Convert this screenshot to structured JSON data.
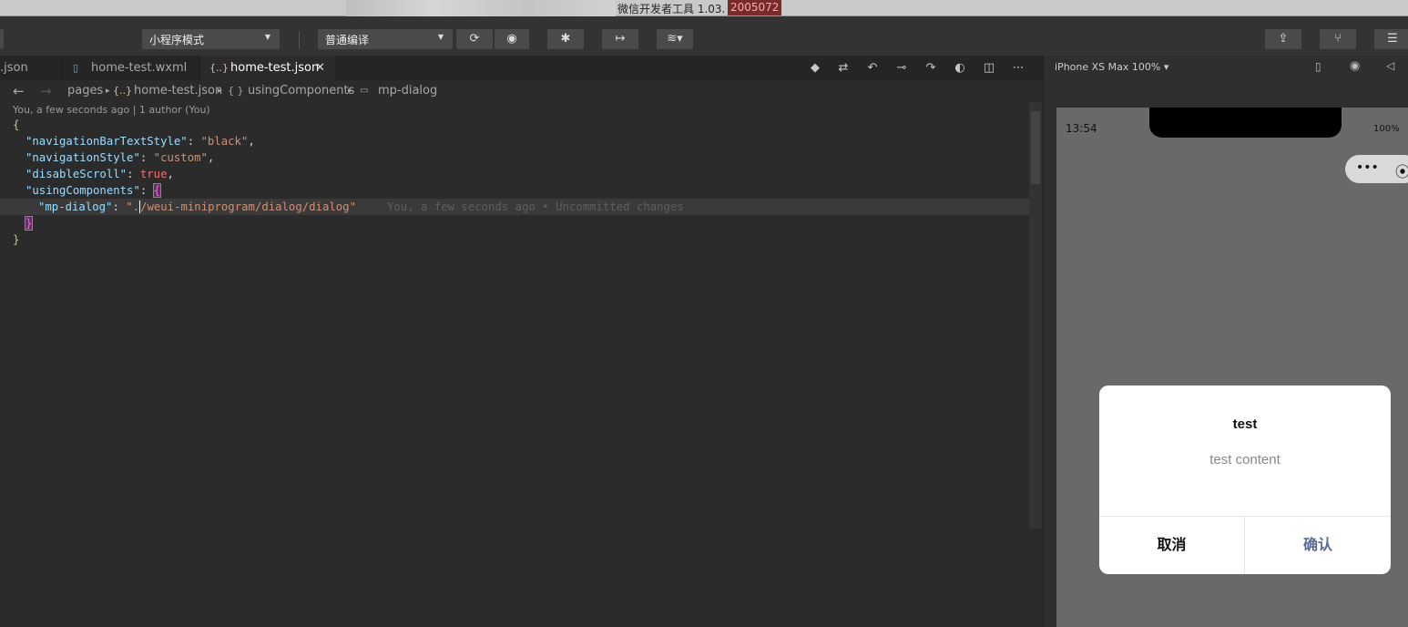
{
  "window": {
    "title": "微信开发者工具 1.03.",
    "build": "2005072"
  },
  "toolbar": {
    "mode_select": "小程序模式",
    "compile_select": "普通编译"
  },
  "tabs": [
    {
      "label": ".json",
      "icon": ""
    },
    {
      "label": "home-test.wxml",
      "icon": "file-icon"
    },
    {
      "label": "home-test.json",
      "icon": "{..}",
      "close": "✕"
    }
  ],
  "breadcrumb": {
    "folder": "pages",
    "file": "home-test.json",
    "file_icon": "{..}",
    "object_icon": "{ }",
    "section": "usingComponents",
    "leaf": "mp-dialog"
  },
  "blame": "You, a few seconds ago | 1 author (You)",
  "code": {
    "open": "{",
    "l1_key": "\"navigationBarTextStyle\"",
    "l1_val": "\"black\"",
    "l2_key": "\"navigationStyle\"",
    "l2_val": "\"custom\"",
    "l3_key": "\"disableScroll\"",
    "l3_val": "true",
    "l4_key": "\"usingComponents\"",
    "l4_open": "{",
    "l5_key": "\"mp-dialog\"",
    "l5_val_a": "\".",
    "l5_val_b": "/weui-miniprogram/dialog/dialog\"",
    "ghost": "You, a few seconds ago • Uncommitted changes",
    "l6": "}",
    "close": "}"
  },
  "simulator": {
    "device": "iPhone XS Max 100% ▾",
    "time": "13:54",
    "battery": "100%",
    "capsule_dots": "•••",
    "capsule_circle": "⦿",
    "dialog": {
      "title": "test",
      "content": "test content",
      "cancel": "取消",
      "confirm": "确认"
    }
  }
}
